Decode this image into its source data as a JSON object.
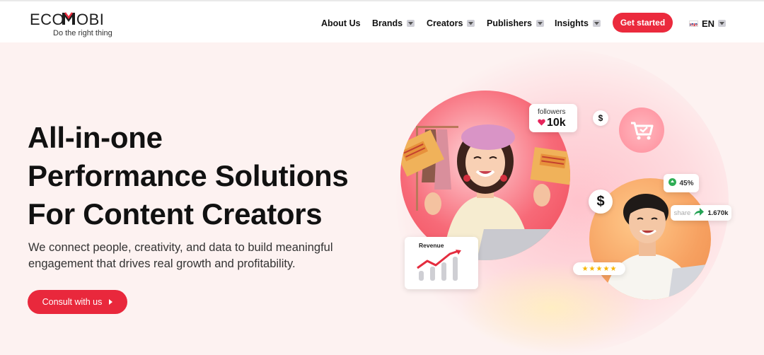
{
  "brand": {
    "name": "ECOMOBI",
    "tagline": "Do the right thing",
    "accent": "#eb2a3d"
  },
  "nav": {
    "items": [
      {
        "label": "About Us",
        "dropdown": false
      },
      {
        "label": "Brands",
        "dropdown": true
      },
      {
        "label": "Creators",
        "dropdown": true
      },
      {
        "label": "Publishers",
        "dropdown": true
      },
      {
        "label": "Insights",
        "dropdown": true
      }
    ],
    "cta": "Get started",
    "language": "EN"
  },
  "hero": {
    "headline": [
      "All-in-one",
      "Performance Solutions",
      "For Content Creators"
    ],
    "subtext": [
      "We connect people, creativity, and data to build meaningful",
      "engagement that drives real growth and profitability."
    ],
    "cta": "Consult with us"
  },
  "illustration": {
    "followers_label": "followers",
    "followers_value": "10k",
    "dollar": "$",
    "percent": "45%",
    "share_label": "share",
    "share_value": "1.670k",
    "revenue_label": "Revenue",
    "rating_stars": 5
  }
}
